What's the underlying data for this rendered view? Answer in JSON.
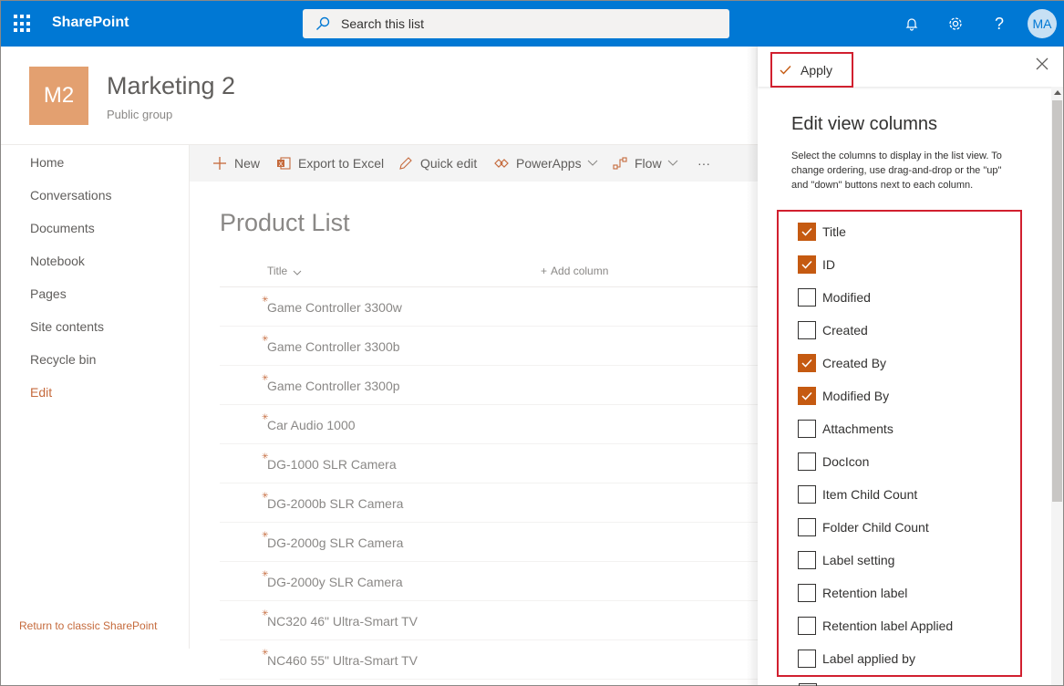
{
  "suitebar": {
    "brand": "SharePoint",
    "search_placeholder": "Search this list",
    "avatar_initials": "MA",
    "accent": "#0078d4"
  },
  "site": {
    "logo_text": "M2",
    "title": "Marketing 2",
    "subtitle": "Public group",
    "logo_color": "#e3a070"
  },
  "nav": {
    "items": [
      "Home",
      "Conversations",
      "Documents",
      "Notebook",
      "Pages",
      "Site contents",
      "Recycle bin",
      "Edit"
    ],
    "classic_link": "Return to classic SharePoint"
  },
  "commandbar": {
    "new": "New",
    "export": "Export to Excel",
    "quick_edit": "Quick edit",
    "powerapps": "PowerApps",
    "flow": "Flow",
    "more": "···"
  },
  "list": {
    "title": "Product List",
    "col_title": "Title",
    "add_column": "Add column",
    "rows": [
      "Game Controller 3300w",
      "Game Controller 3300b",
      "Game Controller 3300p",
      "Car Audio 1000",
      "DG-1000 SLR Camera",
      "DG-2000b SLR Camera",
      "DG-2000g SLR Camera",
      "DG-2000y SLR Camera",
      "NC320 46\" Ultra-Smart TV",
      "NC460 55\" Ultra-Smart TV"
    ]
  },
  "panel": {
    "apply": "Apply",
    "title": "Edit view columns",
    "description": "Select the columns to display in the list view. To change ordering, use drag-and-drop or the \"up\" and \"down\" buttons next to each column.",
    "check_color": "#c55a11",
    "highlight_color": "#d1202f",
    "columns": [
      {
        "label": "Title",
        "checked": true
      },
      {
        "label": "ID",
        "checked": true
      },
      {
        "label": "Modified",
        "checked": false
      },
      {
        "label": "Created",
        "checked": false
      },
      {
        "label": "Created By",
        "checked": true
      },
      {
        "label": "Modified By",
        "checked": true
      },
      {
        "label": "Attachments",
        "checked": false
      },
      {
        "label": "DocIcon",
        "checked": false
      },
      {
        "label": "Item Child Count",
        "checked": false
      },
      {
        "label": "Folder Child Count",
        "checked": false
      },
      {
        "label": "Label setting",
        "checked": false
      },
      {
        "label": "Retention label",
        "checked": false
      },
      {
        "label": "Retention label Applied",
        "checked": false
      },
      {
        "label": "Label applied by",
        "checked": false
      }
    ]
  }
}
